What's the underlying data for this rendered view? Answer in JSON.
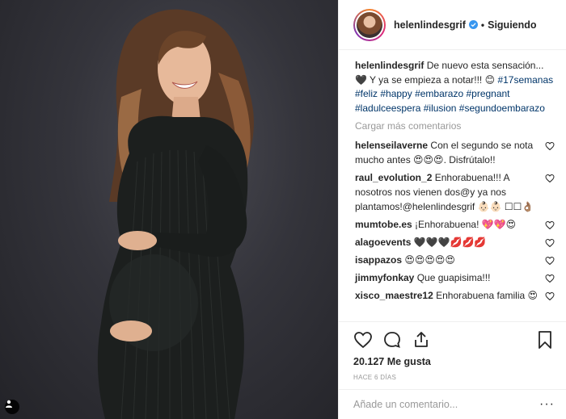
{
  "post": {
    "photo_alt": "pregnant woman in dark ribbed dress",
    "user_tag_icon": "person-icon"
  },
  "header": {
    "username": "helenlindesgrif",
    "verified_icon": "verified-badge-icon",
    "separator": "•",
    "follow_status": "Siguiendo"
  },
  "caption": {
    "username": "helenlindesgrif",
    "text": "De nuevo esta sensación... 🖤 Y ya se empieza a notar!!! 😊",
    "hashtags": [
      "#17semanas",
      "#feliz",
      "#happy",
      "#embarazo",
      "#pregnant",
      "#ladulceespera",
      "#ilusion",
      "#segundoembarazo"
    ]
  },
  "load_more": "Cargar más comentarios",
  "comments": [
    {
      "user": "helenseilaverne",
      "text": "Con el segundo se nota mucho antes 😍😍😍. Disfrútalo!!"
    },
    {
      "user": "raul_evolution_2",
      "text": "Enhorabuena!!! A nosotros nos vienen dos@y ya nos plantamos!@helenlindesgrif 👶🏻👶🏻 ☐☐👌🏽"
    },
    {
      "user": "mumtobe.es",
      "text": "¡Enhorabuena! 💖💖😍"
    },
    {
      "user": "alagoevents",
      "text": "🖤🖤🖤💋💋💋"
    },
    {
      "user": "isappazos",
      "text": "😍😍😍😍😍"
    },
    {
      "user": "jimmyfonkay",
      "text": "Que guapisima!!!"
    },
    {
      "user": "xisco_maestre12",
      "text": "Enhorabuena familia 😍"
    }
  ],
  "actions": {
    "like_icon": "heart-icon",
    "comment_icon": "comment-bubble-icon",
    "share_icon": "share-icon",
    "save_icon": "bookmark-icon"
  },
  "likes": "20.127 Me gusta",
  "time_ago": "HACE 6 DÍAS",
  "add_comment": {
    "placeholder": "Añade un comentario...",
    "more": "···"
  },
  "colors": {
    "text": "#262626",
    "hashtag": "#003569",
    "muted": "#999999",
    "verified": "#3897f0",
    "border": "#efefef"
  }
}
